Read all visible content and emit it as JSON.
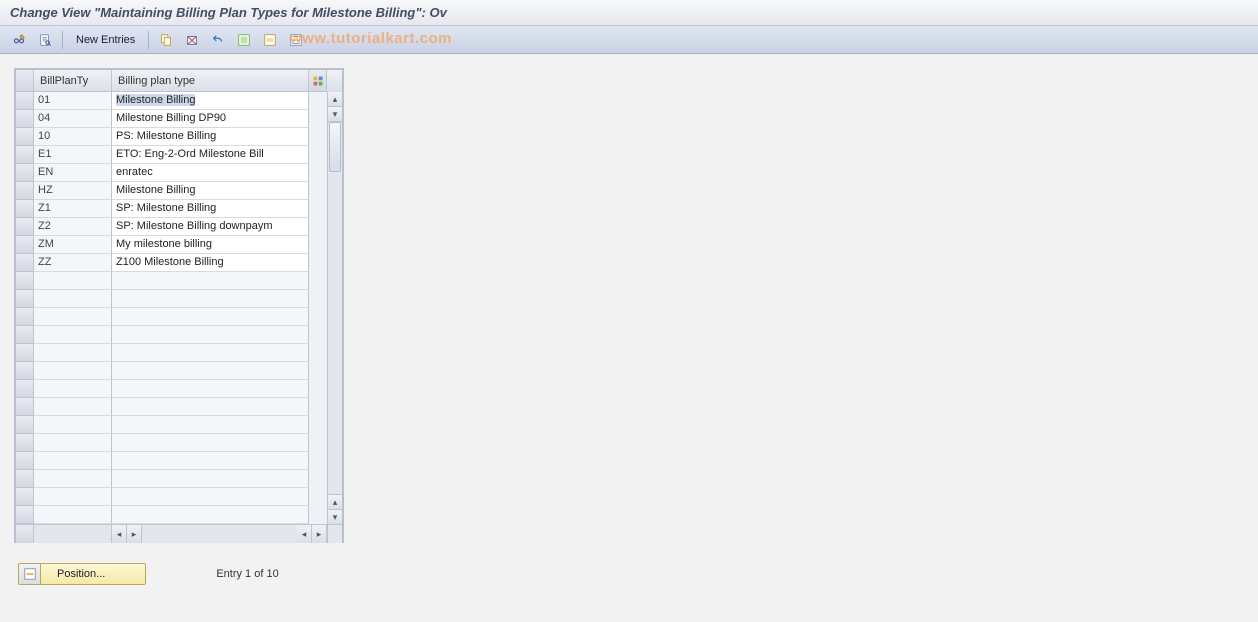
{
  "header": {
    "title": "Change View \"Maintaining Billing Plan Types for Milestone Billing\": Ov"
  },
  "toolbar": {
    "new_entries_label": "New Entries"
  },
  "watermark": "www.tutorialkart.com",
  "table": {
    "columns": {
      "col1": "BillPlanTy",
      "col2": "Billing plan type"
    },
    "rows": [
      {
        "code": "01",
        "desc": "Milestone Billing",
        "selected_text": true
      },
      {
        "code": "04",
        "desc": "Milestone Billing DP90"
      },
      {
        "code": "10",
        "desc": "PS: Milestone Billing"
      },
      {
        "code": "E1",
        "desc": "ETO: Eng-2-Ord Milestone Bill"
      },
      {
        "code": "EN",
        "desc": "enratec"
      },
      {
        "code": "HZ",
        "desc": "Milestone Billing"
      },
      {
        "code": "Z1",
        "desc": "SP: Milestone Billing"
      },
      {
        "code": "Z2",
        "desc": "SP: Milestone Billing downpaym"
      },
      {
        "code": "ZM",
        "desc": "My milestone billing"
      },
      {
        "code": "ZZ",
        "desc": "Z100 Milestone Billing"
      }
    ],
    "empty_rows": 14
  },
  "footer": {
    "position_label": "Position...",
    "entry_status": "Entry 1 of 10"
  }
}
